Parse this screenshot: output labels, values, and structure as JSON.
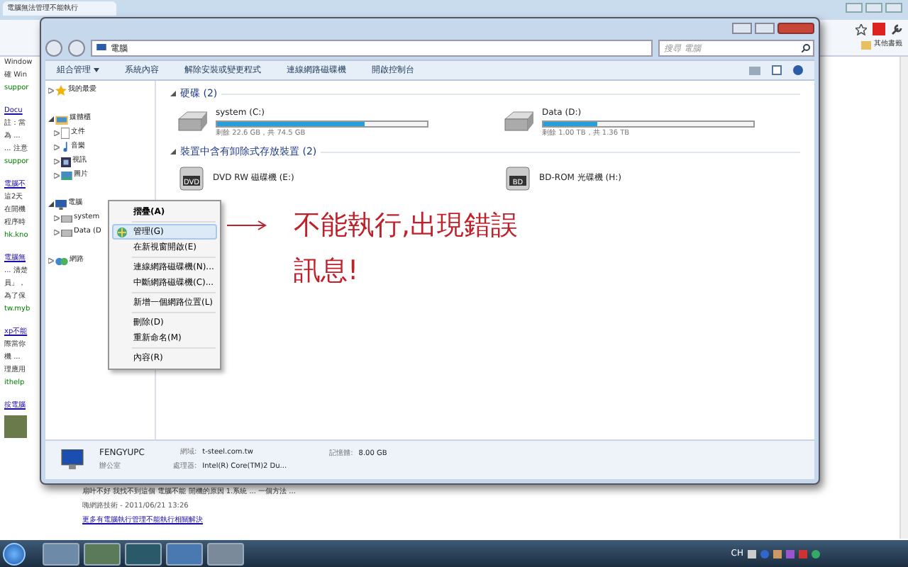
{
  "browser": {
    "tab_title": "電腦無法管理不能執行",
    "bookmark": "其他書籤",
    "page_lines": [
      {
        "kind": "text",
        "text": "Window"
      },
      {
        "kind": "text",
        "text": "確 Win"
      },
      {
        "kind": "url",
        "text": "suppor"
      },
      {
        "kind": "gap"
      },
      {
        "kind": "link",
        "text": "Docu"
      },
      {
        "kind": "text",
        "text": "註：當"
      },
      {
        "kind": "text",
        "text": "為 ..."
      },
      {
        "kind": "text",
        "text": "... 注意"
      },
      {
        "kind": "url",
        "text": "suppor"
      },
      {
        "kind": "gap"
      },
      {
        "kind": "link",
        "text": "電腦不"
      },
      {
        "kind": "text",
        "text": "這2天"
      },
      {
        "kind": "text",
        "text": "在開機"
      },
      {
        "kind": "text",
        "text": "程序時"
      },
      {
        "kind": "url",
        "text": "hk.kno"
      },
      {
        "kind": "gap"
      },
      {
        "kind": "link",
        "text": "電腦無"
      },
      {
        "kind": "text",
        "text": "... 清楚"
      },
      {
        "kind": "text",
        "text": "員」，"
      },
      {
        "kind": "text",
        "text": "為了保"
      },
      {
        "kind": "url",
        "text": "tw.myb"
      },
      {
        "kind": "gap"
      },
      {
        "kind": "link",
        "text": "xp不能"
      },
      {
        "kind": "text",
        "text": "際當你"
      },
      {
        "kind": "text",
        "text": "機 ..."
      },
      {
        "kind": "text",
        "text": "理應用"
      },
      {
        "kind": "url",
        "text": "ithelp"
      },
      {
        "kind": "gap"
      },
      {
        "kind": "link",
        "text": "按電腦"
      }
    ],
    "bottom_lines": [
      {
        "kind": "text",
        "text": "扇叶不好 我找不到這個 電腦不能 開機的原因 1.系統 ... 一個方法 ..."
      },
      {
        "kind": "url",
        "text": "嗨網路技術 - 2011/06/21 13:26"
      },
      {
        "kind": "link",
        "text": "更多有電腦執行管理不能執行相關解決"
      }
    ]
  },
  "explorer": {
    "breadcrumb": "電腦",
    "search": {
      "placeholder": "搜尋 電腦"
    },
    "toolbar": [
      {
        "label": "組合管理",
        "dropdown": true
      },
      {
        "label": "系統內容",
        "dropdown": false
      },
      {
        "label": "解除安裝或變更程式",
        "dropdown": false
      },
      {
        "label": "連線網路磁碟機",
        "dropdown": false
      },
      {
        "label": "開啟控制台",
        "dropdown": false
      }
    ],
    "nav": [
      {
        "label": "我的最愛",
        "kind": "star",
        "expanded": false
      },
      {
        "label": "媒體櫃",
        "kind": "library",
        "expanded": true,
        "children": [
          {
            "label": "文件",
            "kind": "doc"
          },
          {
            "label": "音樂",
            "kind": "music"
          },
          {
            "label": "視訊",
            "kind": "video"
          },
          {
            "label": "圖片",
            "kind": "picture"
          }
        ]
      },
      {
        "label": "電腦",
        "kind": "computer",
        "expanded": true,
        "children": [
          {
            "label": "system",
            "kind": "drive"
          },
          {
            "label": "Data (D",
            "kind": "drive"
          }
        ]
      },
      {
        "label": "網路",
        "kind": "network",
        "expanded": false
      }
    ],
    "groups": [
      {
        "title": "硬碟 (2)",
        "expanded": true,
        "items": [
          {
            "name": "system (C:)",
            "kind": "disk",
            "level": 0.7,
            "info": "剩餘 22.6 GB，共 74.5 GB"
          },
          {
            "name": "Data (D:)",
            "kind": "disk",
            "level": 0.26,
            "info": "剩餘 1.00 TB，共 1.36 TB"
          }
        ]
      },
      {
        "title": "裝置中含有卸除式存放裝置 (2)",
        "expanded": true,
        "items": [
          {
            "name": "DVD RW 磁碟機 (E:)",
            "kind": "optical",
            "badge": "DVD"
          },
          {
            "name": "BD-ROM 光碟機 (H:)",
            "kind": "optical",
            "badge": "BD"
          }
        ]
      }
    ],
    "details": {
      "name": "FENGYUPC",
      "group": "辦公室",
      "fields": [
        {
          "label": "網域:",
          "value": "t-steel.com.tw"
        },
        {
          "label": "處理器:",
          "value": "Intel(R) Core(TM)2 Du..."
        },
        {
          "label": "記憶體:",
          "value": "8.00 GB"
        }
      ]
    }
  },
  "context_menu": [
    {
      "label": "摺疊(A)",
      "bold": true,
      "selected": false,
      "separator_after": true
    },
    {
      "label": "管理(G)",
      "bold": false,
      "selected": true,
      "separator_after": false
    },
    {
      "label": "在新視窗開啟(E)",
      "bold": false,
      "selected": false,
      "separator_after": true
    },
    {
      "label": "連線網路磁碟機(N)...",
      "bold": false,
      "selected": false,
      "separator_after": false
    },
    {
      "label": "中斷網路磁碟機(C)...",
      "bold": false,
      "selected": false,
      "separator_after": true
    },
    {
      "label": "新增一個網路位置(L)",
      "bold": false,
      "selected": false,
      "separator_after": true
    },
    {
      "label": "刪除(D)",
      "bold": false,
      "selected": false,
      "separator_after": false
    },
    {
      "label": "重新命名(M)",
      "bold": false,
      "selected": false,
      "separator_after": true
    },
    {
      "label": "內容(R)",
      "bold": false,
      "selected": false,
      "separator_after": false
    }
  ],
  "annotation": {
    "lines": [
      "不能執行,出現錯誤",
      "訊息!"
    ]
  },
  "taskbar": {
    "language": "CH"
  }
}
